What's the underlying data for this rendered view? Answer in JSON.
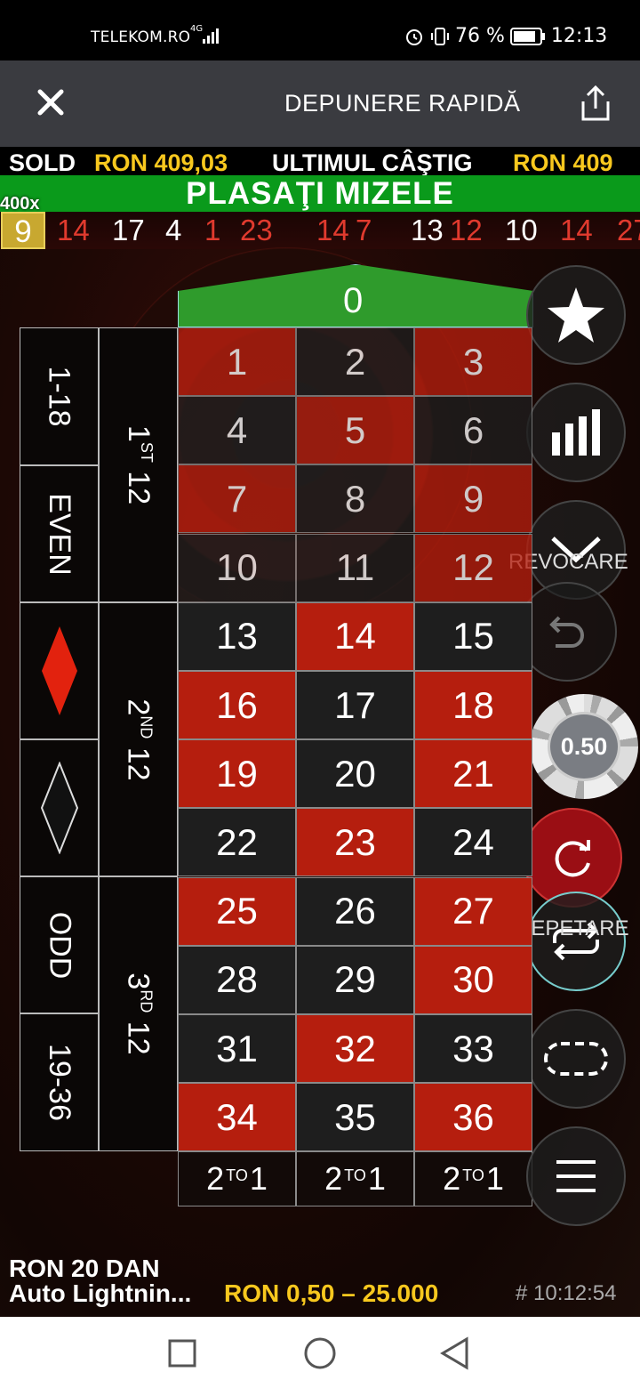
{
  "status": {
    "carrier": "TELEKOM.RO",
    "network": "4G",
    "battery": "76 %",
    "time": "12:13"
  },
  "header": {
    "title": "DEPUNERE RAPIDĂ"
  },
  "balance": {
    "sold_label": "SOLD",
    "sold_value": "RON 409,03",
    "last_label": "ULTIMUL CÂŞTIG",
    "last_value": "RON 409"
  },
  "banner": {
    "text": "PLASAŢI MIZELE",
    "multiplier": "400x"
  },
  "history": {
    "highlight": "9",
    "numbers": [
      {
        "n": "14",
        "c": "red"
      },
      {
        "n": "17",
        "c": "black"
      },
      {
        "n": "4",
        "c": "black"
      },
      {
        "n": "1",
        "c": "red"
      },
      {
        "n": "23",
        "c": "red"
      },
      {
        "n": "14",
        "c": "red"
      },
      {
        "n": "7",
        "c": "red"
      },
      {
        "n": "13",
        "c": "black"
      },
      {
        "n": "12",
        "c": "red"
      },
      {
        "n": "10",
        "c": "black"
      },
      {
        "n": "14",
        "c": "red"
      },
      {
        "n": "27",
        "c": "red"
      }
    ]
  },
  "table": {
    "zero": "0",
    "numbers": [
      {
        "n": "1",
        "c": "red"
      },
      {
        "n": "2",
        "c": "black"
      },
      {
        "n": "3",
        "c": "red"
      },
      {
        "n": "4",
        "c": "black"
      },
      {
        "n": "5",
        "c": "red"
      },
      {
        "n": "6",
        "c": "black"
      },
      {
        "n": "7",
        "c": "red"
      },
      {
        "n": "8",
        "c": "black"
      },
      {
        "n": "9",
        "c": "red"
      },
      {
        "n": "10",
        "c": "black"
      },
      {
        "n": "11",
        "c": "black"
      },
      {
        "n": "12",
        "c": "red"
      },
      {
        "n": "13",
        "c": "black"
      },
      {
        "n": "14",
        "c": "red"
      },
      {
        "n": "15",
        "c": "black"
      },
      {
        "n": "16",
        "c": "red"
      },
      {
        "n": "17",
        "c": "black"
      },
      {
        "n": "18",
        "c": "red"
      },
      {
        "n": "19",
        "c": "red"
      },
      {
        "n": "20",
        "c": "black"
      },
      {
        "n": "21",
        "c": "red"
      },
      {
        "n": "22",
        "c": "black"
      },
      {
        "n": "23",
        "c": "red"
      },
      {
        "n": "24",
        "c": "black"
      },
      {
        "n": "25",
        "c": "red"
      },
      {
        "n": "26",
        "c": "black"
      },
      {
        "n": "27",
        "c": "red"
      },
      {
        "n": "28",
        "c": "black"
      },
      {
        "n": "29",
        "c": "black"
      },
      {
        "n": "30",
        "c": "red"
      },
      {
        "n": "31",
        "c": "black"
      },
      {
        "n": "32",
        "c": "red"
      },
      {
        "n": "33",
        "c": "black"
      },
      {
        "n": "34",
        "c": "red"
      },
      {
        "n": "35",
        "c": "black"
      },
      {
        "n": "36",
        "c": "red"
      }
    ],
    "column_bets": [
      "2",
      "TO",
      "1"
    ],
    "outside": {
      "low": "1-18",
      "even": "EVEN",
      "odd": "ODD",
      "high": "19-36"
    },
    "dozens": [
      {
        "num": "1",
        "suffix": "ST",
        "rest": " 12"
      },
      {
        "num": "2",
        "suffix": "ND",
        "rest": " 12"
      },
      {
        "num": "3",
        "suffix": "RD",
        "rest": " 12"
      }
    ],
    "colors": {
      "red": "#b51e0e",
      "black": "#1e1e1e",
      "green": "#2f9b2c"
    }
  },
  "controls": {
    "revoke_label": "REVOCARE",
    "repeat_label": "REPETARE",
    "chip_value": "0.50"
  },
  "footer": {
    "line1": "RON 20 DAN",
    "line2": "Auto Lightnin...",
    "limits": "RON 0,50 – 25.000",
    "game_id": "# 10:12:54"
  }
}
